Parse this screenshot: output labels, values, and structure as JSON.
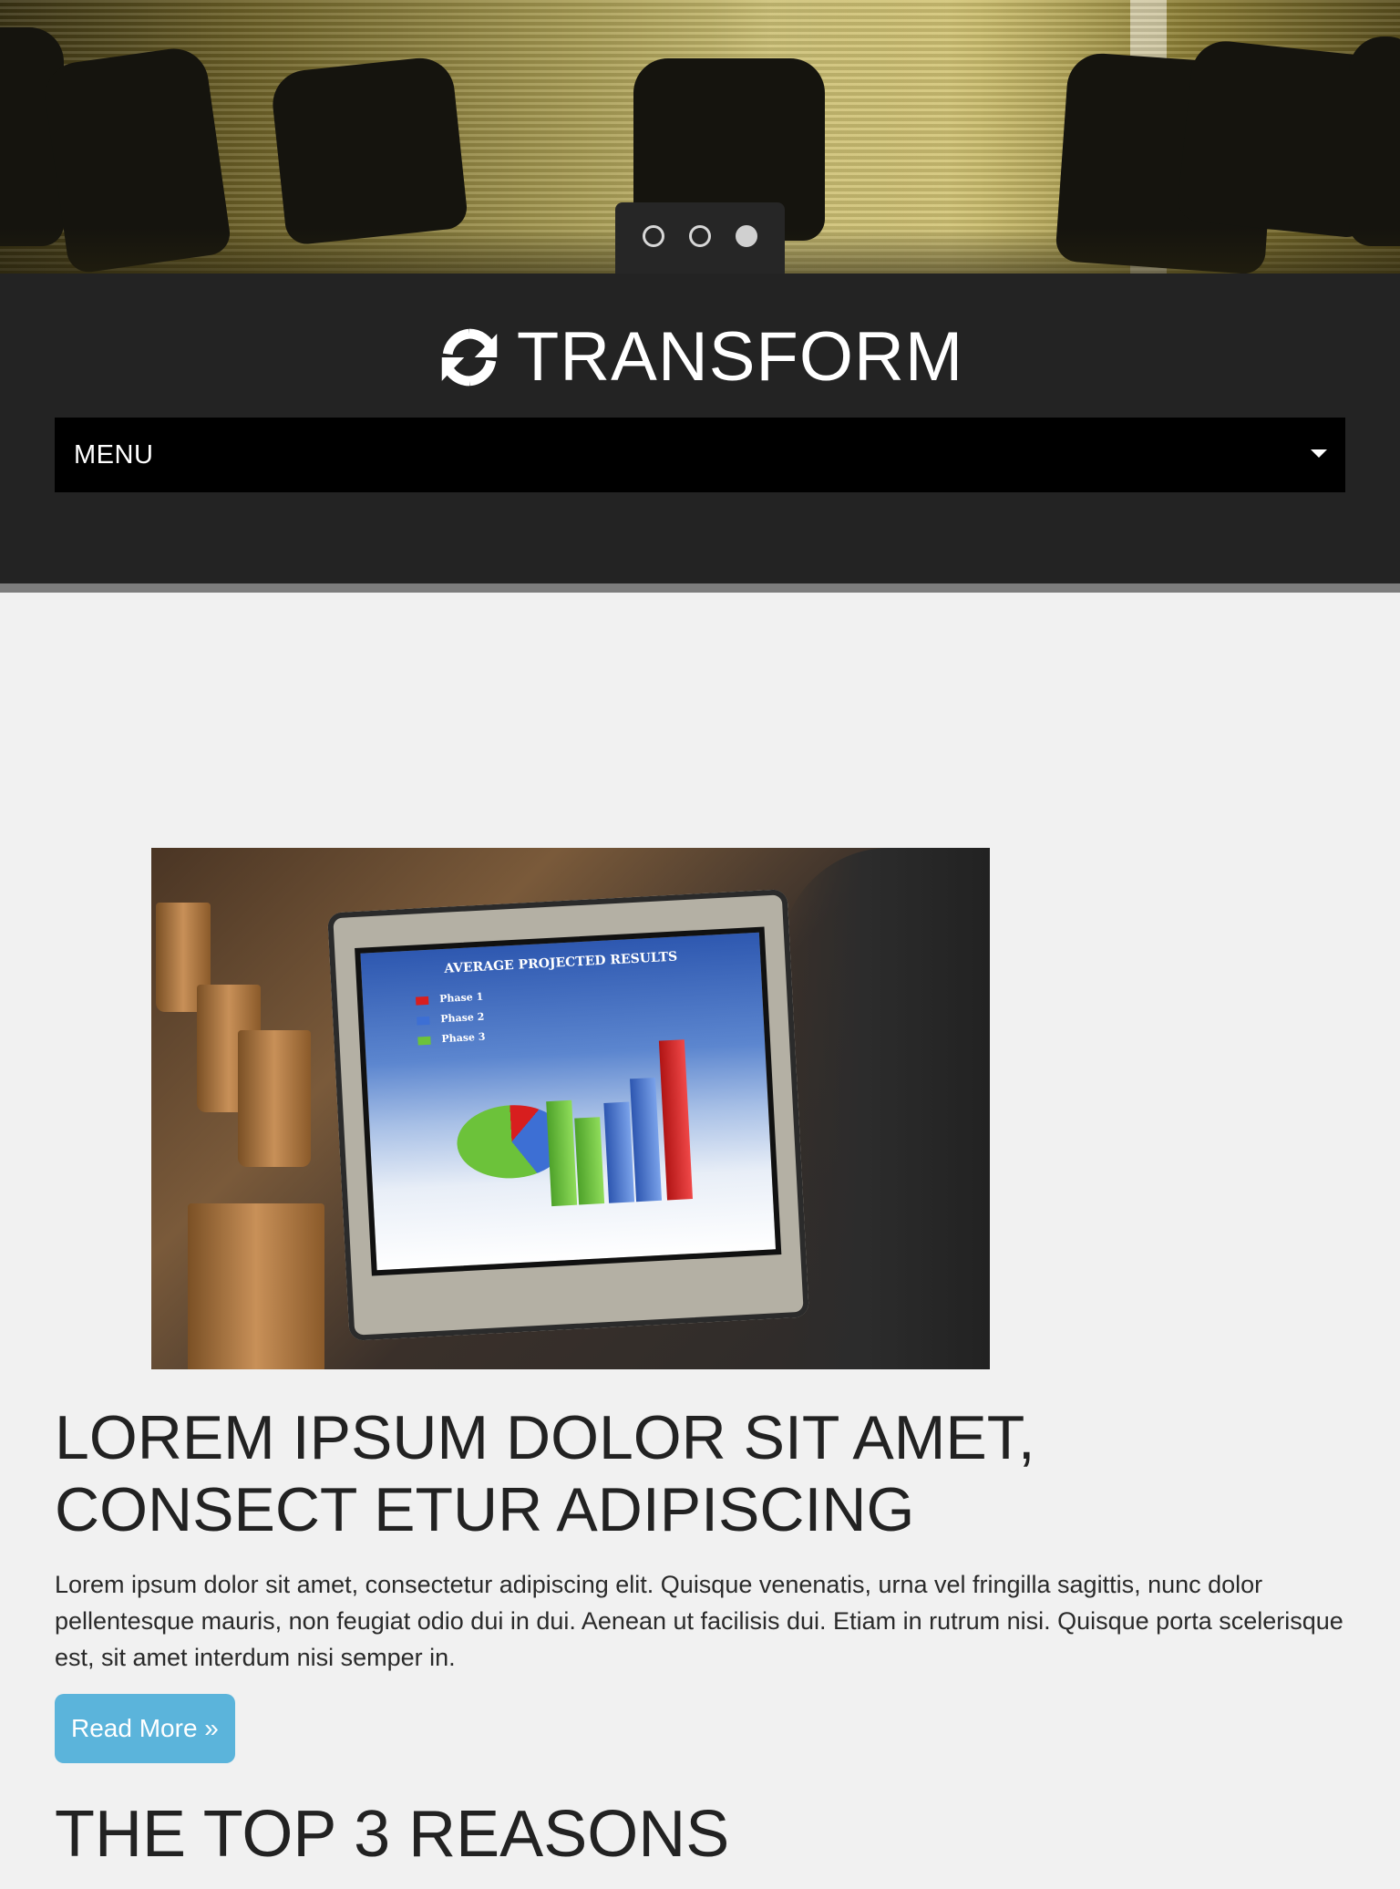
{
  "hero": {
    "slides_total": 3,
    "active_slide": 3
  },
  "header": {
    "brand_icon": "refresh-icon",
    "brand_name": "TRANSFORM",
    "menu_label": "MENU",
    "menu_icon": "caret-down-icon"
  },
  "article": {
    "image_chart": {
      "title": "AVERAGE PROJECTED RESULTS",
      "legend": [
        "Phase 1",
        "Phase 2",
        "Phase 3"
      ],
      "legend_colors": [
        "#d81e1e",
        "#3d6fd4",
        "#6cc23a"
      ]
    },
    "headline": "LOREM IPSUM DOLOR SIT AMET, CONSECT ETUR ADIPISCING",
    "body": "Lorem ipsum dolor sit amet, consectetur adipiscing elit. Quisque venenatis, urna vel fringilla sagittis, nunc dolor pellentesque mauris, non feugiat odio dui in dui. Aenean ut facilisis dui. Etiam in rutrum nisi. Quisque porta scelerisque est, sit amet interdum nisi semper in.",
    "read_more_label": "Read More »"
  },
  "sections": {
    "top_reasons_heading": "THE TOP 3 REASONS"
  },
  "colors": {
    "header_bg": "#232323",
    "menu_bg": "#000000",
    "button_bg": "#5bb4db",
    "page_bg": "#f1f1f1"
  }
}
